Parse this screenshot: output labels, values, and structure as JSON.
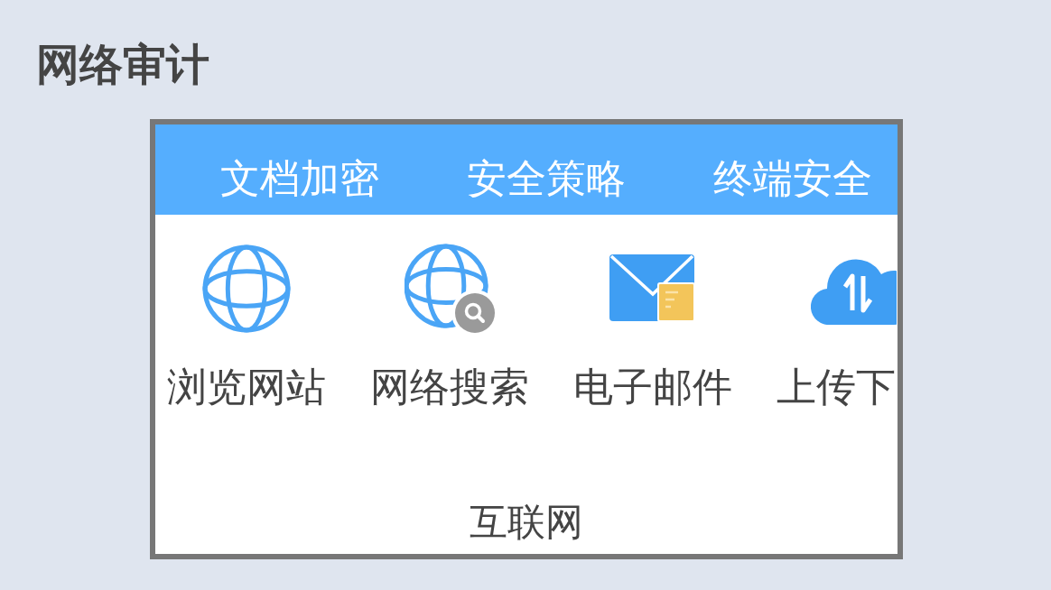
{
  "title": "网络审计",
  "tabs": [
    {
      "label": "文档加密"
    },
    {
      "label": "安全策略"
    },
    {
      "label": "终端安全"
    }
  ],
  "apps": [
    {
      "kind": "globe",
      "label": "浏览网站"
    },
    {
      "kind": "globe-search",
      "label": "网络搜索"
    },
    {
      "kind": "mail",
      "label": "电子邮件"
    },
    {
      "kind": "cloud-transfer",
      "label": "上传下"
    }
  ],
  "group_label": "互联网"
}
